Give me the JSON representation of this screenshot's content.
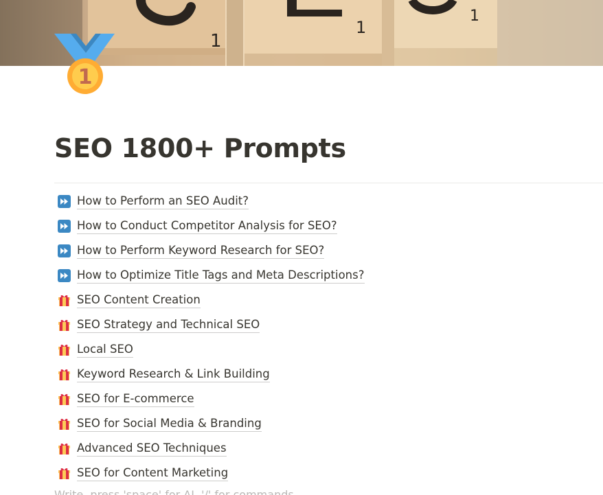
{
  "page": {
    "title": "SEO 1800+ Prompts",
    "icon": "1st-place-medal-icon",
    "placeholder": "Write, press 'space' for AI, '/' for commands…"
  },
  "colors": {
    "text": "#37352f",
    "medal_ribbon": "#55acee",
    "medal_gold": "#ffac33",
    "fast_forward_box": "#3b88c3",
    "gift_red": "#dd2e44",
    "gift_gold": "#fdcb58"
  },
  "links": [
    {
      "icon": "fast-forward-icon",
      "label": "How to Perform an SEO Audit?"
    },
    {
      "icon": "fast-forward-icon",
      "label": "How to Conduct Competitor Analysis for SEO?"
    },
    {
      "icon": "fast-forward-icon",
      "label": "How to Perform Keyword Research for SEO?"
    },
    {
      "icon": "fast-forward-icon",
      "label": "How to Optimize Title Tags and Meta Descriptions?"
    },
    {
      "icon": "gift-icon",
      "label": "SEO Content Creation"
    },
    {
      "icon": "gift-icon",
      "label": "SEO Strategy and Technical SEO"
    },
    {
      "icon": "gift-icon",
      "label": "Local SEO"
    },
    {
      "icon": "gift-icon",
      "label": "Keyword Research & Link Building"
    },
    {
      "icon": "gift-icon",
      "label": "SEO for E-commerce"
    },
    {
      "icon": "gift-icon",
      "label": "SEO for Social Media & Branding"
    },
    {
      "icon": "gift-icon",
      "label": "Advanced SEO Techniques"
    },
    {
      "icon": "gift-icon",
      "label": "SEO for Content Marketing"
    }
  ]
}
